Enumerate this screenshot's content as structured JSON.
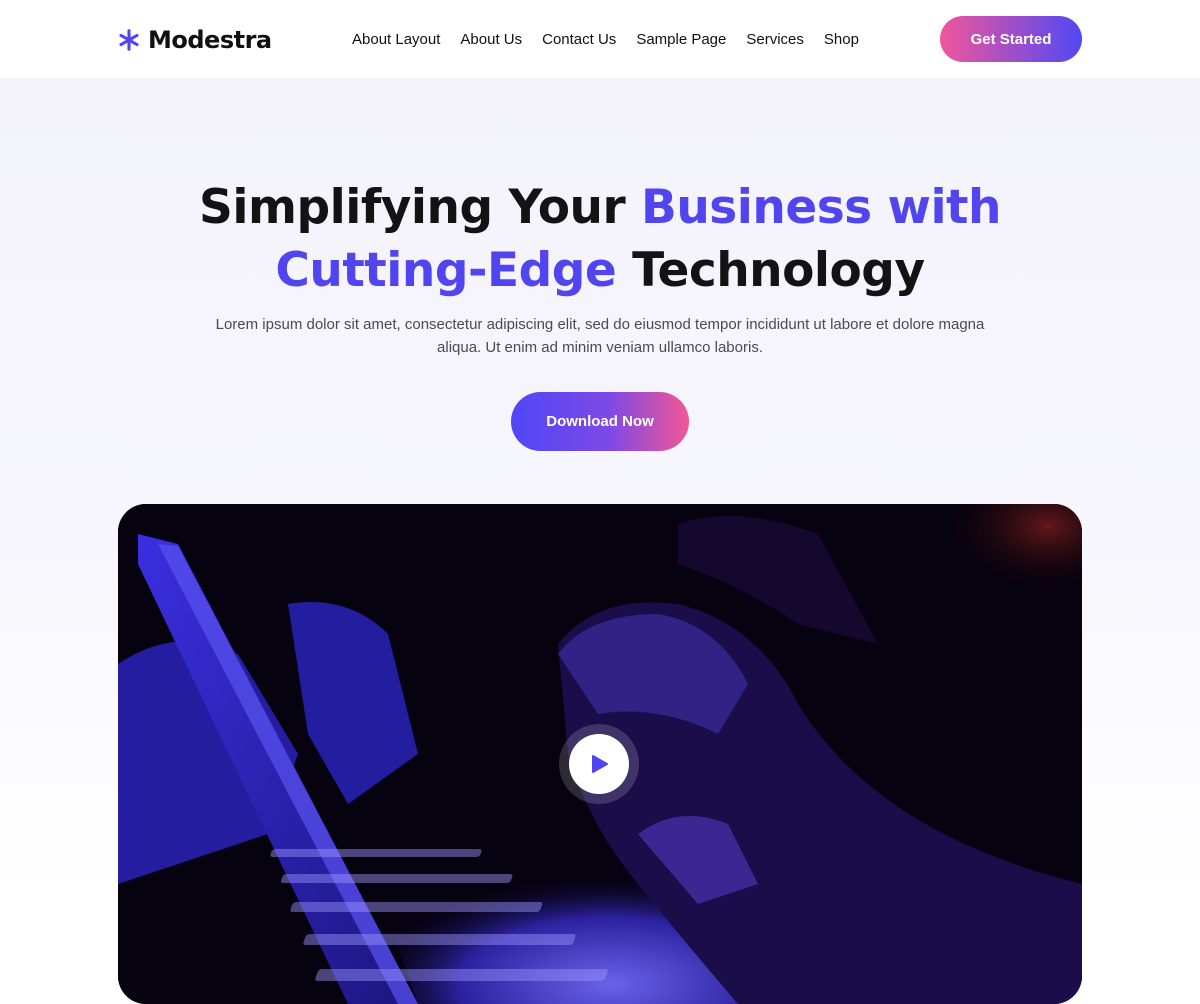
{
  "brand": {
    "name": "Modestra",
    "icon": "asterisk-icon",
    "accent_color": "#5145f0"
  },
  "nav": {
    "items": [
      {
        "label": "About Layout"
      },
      {
        "label": "About Us"
      },
      {
        "label": "Contact Us"
      },
      {
        "label": "Sample Page"
      },
      {
        "label": "Services"
      },
      {
        "label": "Shop"
      }
    ],
    "cta_label": "Get Started"
  },
  "hero": {
    "title_part1": "Simplifying Your ",
    "title_accent1": "Business with",
    "title_accent2": "Cutting-Edge",
    "title_part2": " Technology",
    "description": "Lorem ipsum dolor sit amet, consectetur adipiscing elit, sed do eiusmod tempor incididunt ut labore et dolore magna aliqua. Ut enim ad minim veniam ullamco laboris.",
    "button_label": "Download Now"
  },
  "video": {
    "play_icon": "play-icon"
  },
  "colors": {
    "gradient_pink": "#f0569b",
    "gradient_blue": "#5148f5",
    "hero_background": "#f5f4fc",
    "title_text": "#131313"
  }
}
